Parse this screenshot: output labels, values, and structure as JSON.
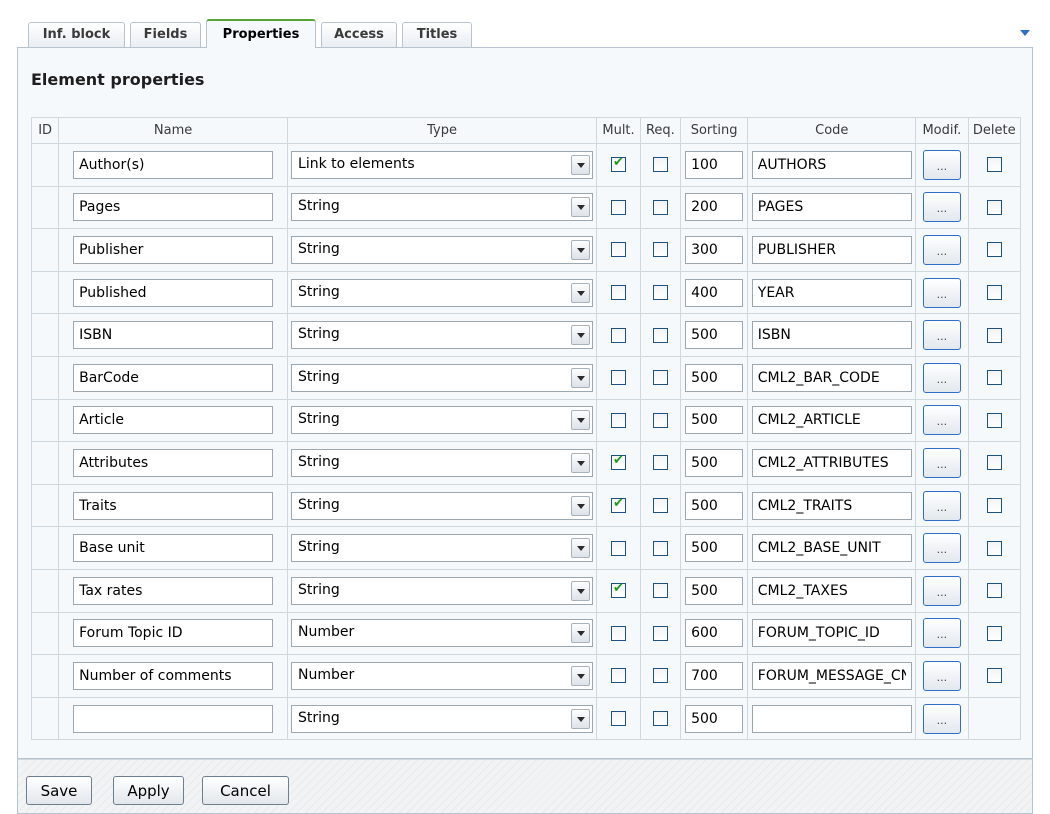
{
  "tabs": [
    {
      "label": "Inf. block",
      "active": false
    },
    {
      "label": "Fields",
      "active": false
    },
    {
      "label": "Properties",
      "active": true
    },
    {
      "label": "Access",
      "active": false
    },
    {
      "label": "Titles",
      "active": false
    }
  ],
  "section_title": "Element properties",
  "columns": {
    "id": "ID",
    "name": "Name",
    "type": "Type",
    "mult": "Mult.",
    "req": "Req.",
    "sorting": "Sorting",
    "code": "Code",
    "modif": "Modif.",
    "delete": "Delete"
  },
  "modif_button_label": "...",
  "rows": [
    {
      "name": "Author(s)",
      "type": "Link to elements",
      "multiple": true,
      "required": false,
      "sort": "100",
      "code": "AUTHORS",
      "deletable": true
    },
    {
      "name": "Pages",
      "type": "String",
      "multiple": false,
      "required": false,
      "sort": "200",
      "code": "PAGES",
      "deletable": true
    },
    {
      "name": "Publisher",
      "type": "String",
      "multiple": false,
      "required": false,
      "sort": "300",
      "code": "PUBLISHER",
      "deletable": true
    },
    {
      "name": "Published",
      "type": "String",
      "multiple": false,
      "required": false,
      "sort": "400",
      "code": "YEAR",
      "deletable": true
    },
    {
      "name": "ISBN",
      "type": "String",
      "multiple": false,
      "required": false,
      "sort": "500",
      "code": "ISBN",
      "deletable": true
    },
    {
      "name": "BarCode",
      "type": "String",
      "multiple": false,
      "required": false,
      "sort": "500",
      "code": "CML2_BAR_CODE",
      "deletable": true
    },
    {
      "name": "Article",
      "type": "String",
      "multiple": false,
      "required": false,
      "sort": "500",
      "code": "CML2_ARTICLE",
      "deletable": true
    },
    {
      "name": "Attributes",
      "type": "String",
      "multiple": true,
      "required": false,
      "sort": "500",
      "code": "CML2_ATTRIBUTES",
      "deletable": true
    },
    {
      "name": "Traits",
      "type": "String",
      "multiple": true,
      "required": false,
      "sort": "500",
      "code": "CML2_TRAITS",
      "deletable": true
    },
    {
      "name": "Base unit",
      "type": "String",
      "multiple": false,
      "required": false,
      "sort": "500",
      "code": "CML2_BASE_UNIT",
      "deletable": true
    },
    {
      "name": "Tax rates",
      "type": "String",
      "multiple": true,
      "required": false,
      "sort": "500",
      "code": "CML2_TAXES",
      "deletable": true
    },
    {
      "name": "Forum Topic ID",
      "type": "Number",
      "multiple": false,
      "required": false,
      "sort": "600",
      "code": "FORUM_TOPIC_ID",
      "deletable": true
    },
    {
      "name": "Number of comments",
      "type": "Number",
      "multiple": false,
      "required": false,
      "sort": "700",
      "code": "FORUM_MESSAGE_CNT",
      "deletable": true
    },
    {
      "name": "",
      "type": "String",
      "multiple": false,
      "required": false,
      "sort": "500",
      "code": "",
      "deletable": false
    }
  ],
  "buttons": {
    "save": "Save",
    "apply": "Apply",
    "cancel": "Cancel"
  }
}
